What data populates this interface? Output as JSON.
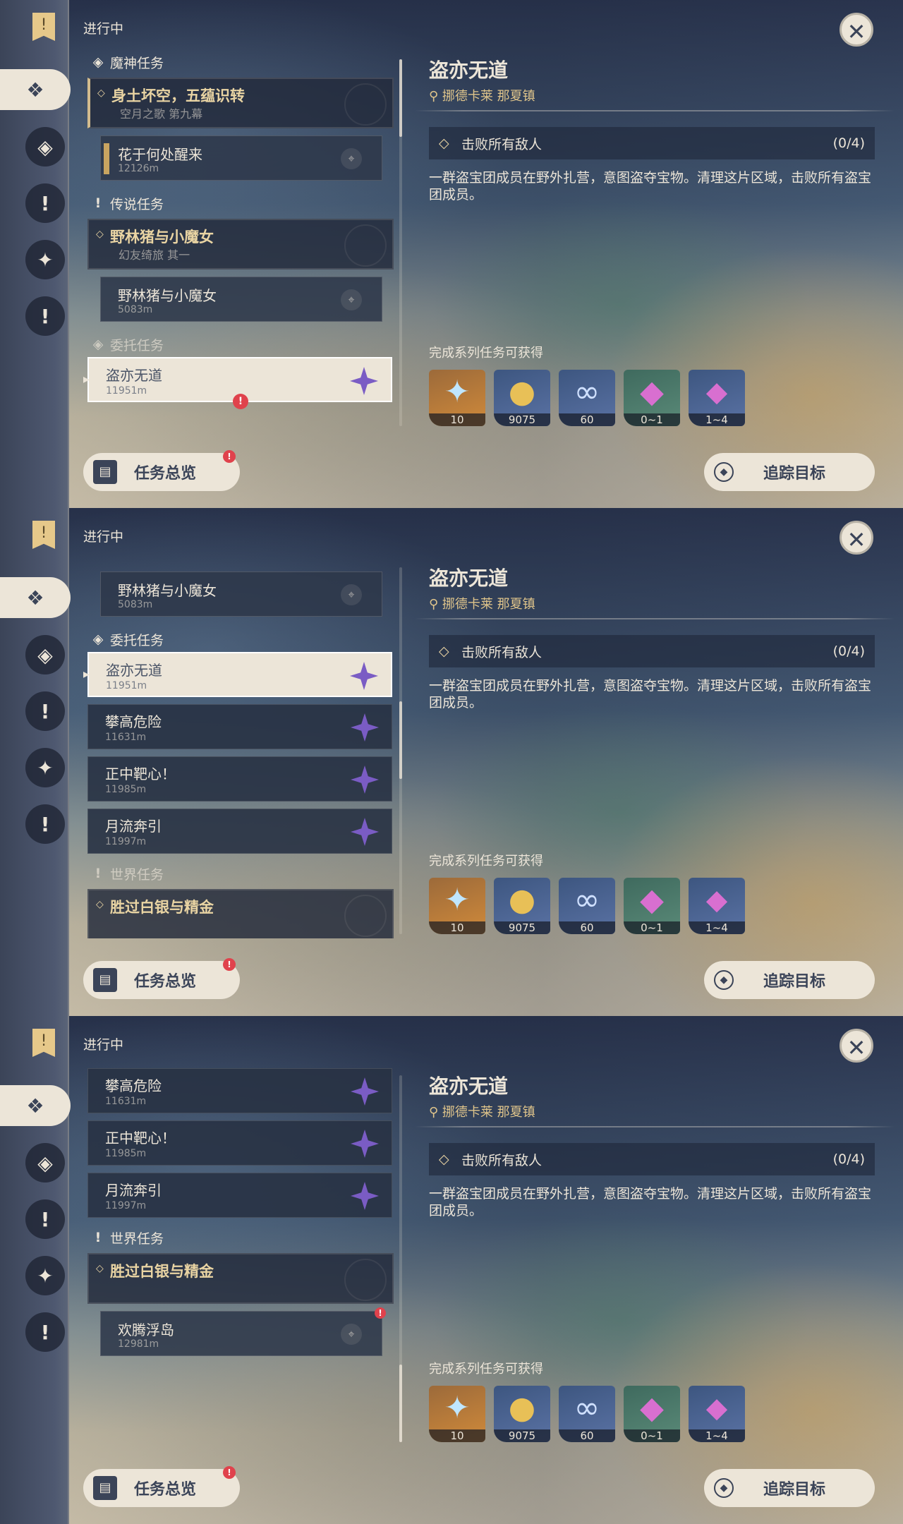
{
  "header": {
    "title": "进行中"
  },
  "sections": {
    "archon": "魔神任务",
    "legend": "传说任务",
    "commission": "委托任务",
    "world": "世界任务"
  },
  "quests": {
    "archon_main": {
      "title": "身土坏空，五蕴识转",
      "sub": "空月之歌 第九幕"
    },
    "archon_step": {
      "title": "花于何处醒来",
      "dist": "12126m"
    },
    "legend_main": {
      "title": "野林猪与小魔女",
      "sub": "幻友绮旅 其一"
    },
    "legend_step": {
      "title": "野林猪与小魔女",
      "dist": "5083m"
    },
    "c1": {
      "title": "盗亦无道",
      "dist": "11951m"
    },
    "c2": {
      "title": "攀高危险",
      "dist": "11631m"
    },
    "c3": {
      "title": "正中靶心！",
      "dist": "11985m"
    },
    "c4": {
      "title": "月流奔引",
      "dist": "11997m"
    },
    "world_main": {
      "title": "胜过白银与精金"
    },
    "world_step": {
      "title": "欢腾浮岛",
      "dist": "12981m"
    }
  },
  "detail": {
    "title": "盗亦无道",
    "location": "挪德卡莱 那夏镇",
    "objective": "击败所有敌人",
    "objective_count": "(0/4)",
    "description": "一群盗宝团成员在野外扎营，意图盗夺宝物。清理这片区域，击败所有盗宝团成员。",
    "rewards_label": "完成系列任务可获得",
    "rewards": [
      {
        "icon": "primogem-icon",
        "count": "10"
      },
      {
        "icon": "mora-icon",
        "count": "9075"
      },
      {
        "icon": "exp-icon",
        "count": "60"
      },
      {
        "icon": "crystal-icon",
        "count": "0~1"
      },
      {
        "icon": "crystal-cluster-icon",
        "count": "1~4"
      }
    ]
  },
  "buttons": {
    "overview": "任务总览",
    "track": "追踪目标"
  },
  "colors": {
    "accent": "#ece5d8",
    "gold": "#d3bc8e",
    "alert": "#e0424c",
    "commission_star": "#7a5cc4"
  }
}
